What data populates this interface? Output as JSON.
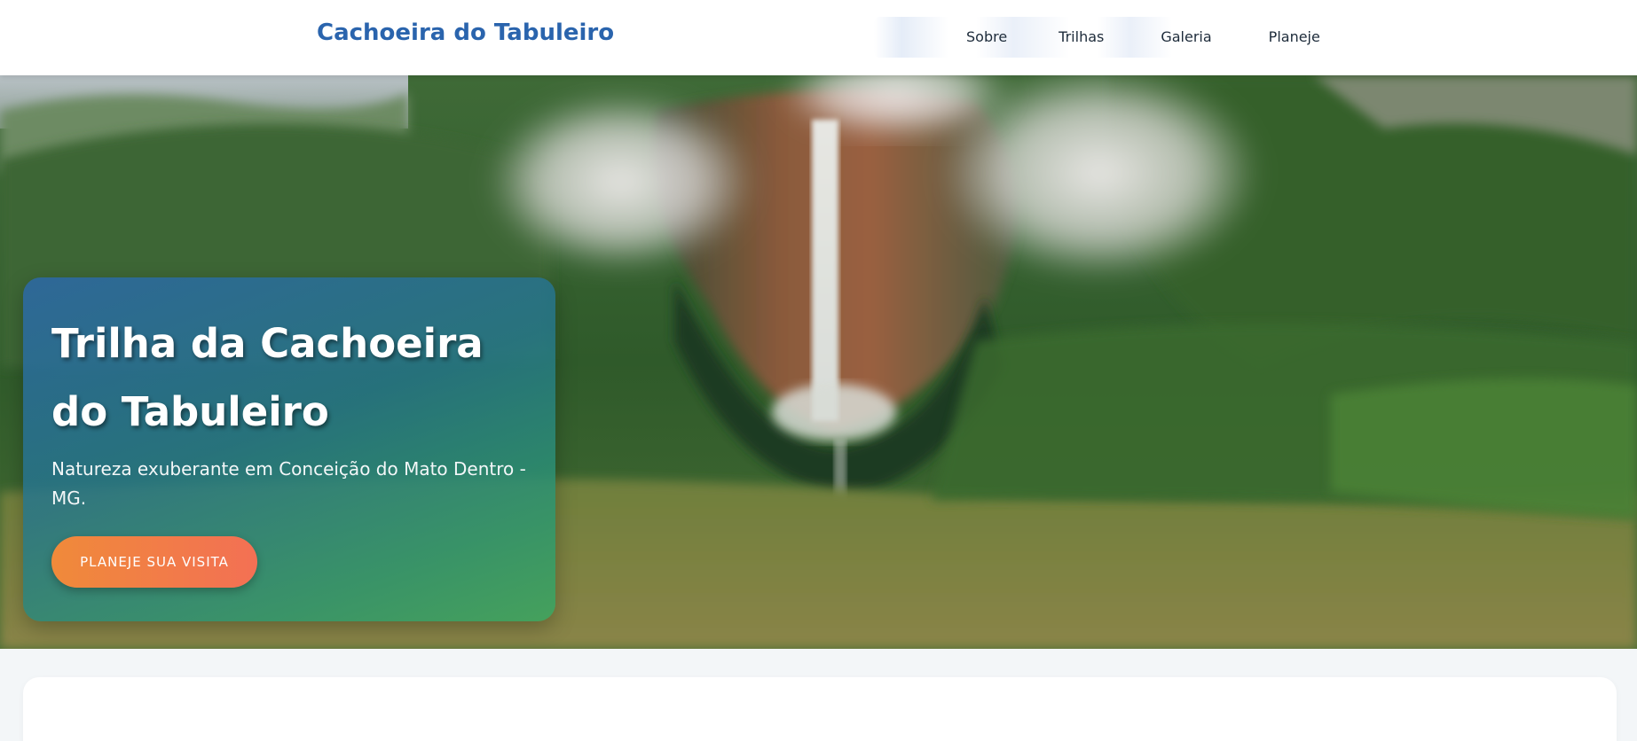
{
  "header": {
    "brand": "Cachoeira do Tabuleiro",
    "nav": [
      {
        "label": "Sobre"
      },
      {
        "label": "Trilhas"
      },
      {
        "label": "Galeria"
      },
      {
        "label": "Planeje"
      }
    ]
  },
  "hero": {
    "background_image": "waterfall-landscape",
    "title": "Trilha da Cachoeira do Tabuleiro",
    "subtitle": "Natureza exuberante em Conceição do Mato Dentro - MG.",
    "cta_label": "PLANEJE SUA VISITA"
  },
  "colors": {
    "brand": "#2a64ad",
    "cta_start": "#f08a3a",
    "cta_end": "#f37054",
    "card_start": "#2c68a5",
    "card_end": "#3ca55f",
    "page_bg": "#f3f6f8"
  }
}
